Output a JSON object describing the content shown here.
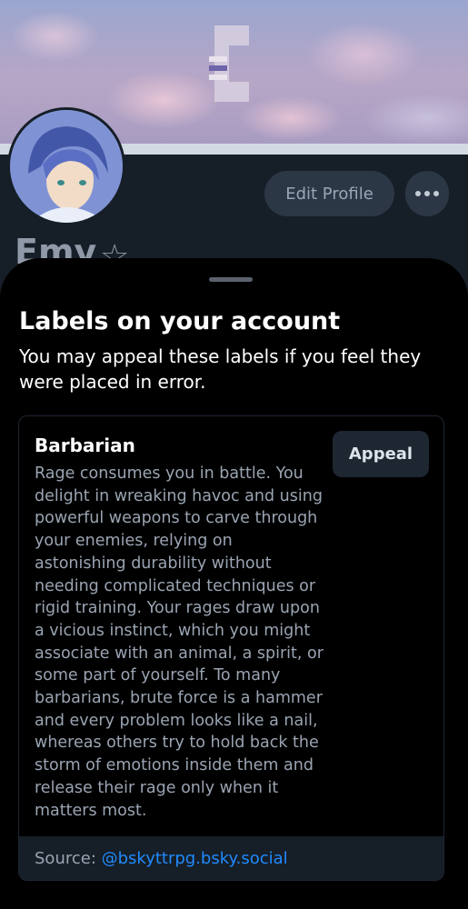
{
  "profile": {
    "name": "Emy",
    "edit_label": "Edit Profile"
  },
  "sheet": {
    "title": "Labels on your account",
    "description": "You may appeal these labels if you feel they were placed in error.",
    "label": {
      "name": "Barbarian",
      "appeal_label": "Appeal",
      "description": "Rage consumes you in battle. You delight in wreaking havoc and using powerful weapons to carve through your enemies, relying on astonishing durability without needing complicated techniques or rigid training. Your rages draw upon a vicious instinct, which you might associate with an animal, a spirit, or some part of yourself. To many barbarians, brute force is a hammer and every problem looks like a nail, whereas others try to hold back the storm of emotions inside them and release their rage only when it matters most.",
      "source_prefix": "Source: ",
      "source_handle": "@bskyttrpg.bsky.social"
    }
  },
  "colors": {
    "accent": "#208bfe",
    "sheet_bg": "#000000",
    "card_footer_bg": "#161e27",
    "muted_text": "#9aa4b2"
  },
  "icons": {
    "more": "ellipsis-icon",
    "star": "star-icon",
    "handle": "drag-handle"
  }
}
